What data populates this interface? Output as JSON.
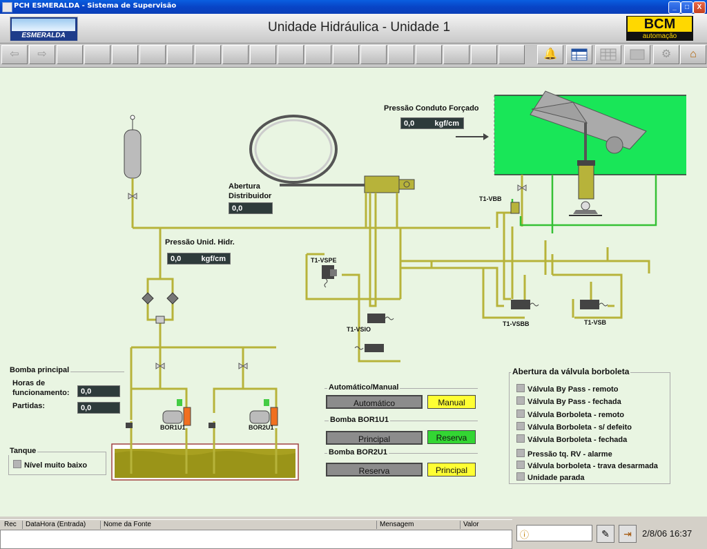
{
  "window": {
    "title": "PCH ESMERALDA - Sistema de Supervisão",
    "min": "_",
    "max": "□",
    "close": "X"
  },
  "header": {
    "logo_text": "ESMERALDA",
    "title": "Unidade Hidráulica - Unidade 1",
    "brand_top": "BCM",
    "brand_bottom": "automação"
  },
  "toolbar": {
    "back_icon": "arrow-left-icon",
    "forward_icon": "arrow-right-icon",
    "bell_icon": "bell-icon",
    "table_icon": "table-icon",
    "grid_icon": "grid-icon",
    "panel_icon": "panel-icon",
    "tools_icon": "tools-icon",
    "home_icon": "home-icon"
  },
  "readouts": {
    "conduto": {
      "label": "Pressão Conduto Forçado",
      "value": "0,0",
      "unit": "kgf/cm"
    },
    "distribuidor": {
      "label_line1": "Abertura",
      "label_line2": "Distribuidor",
      "value": "0,0"
    },
    "unid_hidr": {
      "label": "Pressão Unid. Hidr.",
      "value": "0,0",
      "unit": "kgf/cm"
    }
  },
  "valves": {
    "vbb": "T1-VBB",
    "vspe": "T1-VSPE",
    "vsio": "T1-VSIO",
    "vsbb": "T1-VSBB",
    "vsb": "T1-VSB"
  },
  "pumps": {
    "p1": "BOR1U1",
    "p2": "BOR2U1"
  },
  "bomba_principal": {
    "title": "Bomba principal",
    "horas_l1": "Horas de",
    "horas_l2": "funcionamento:",
    "horas_value": "0,0",
    "partidas_label": "Partidas:",
    "partidas_value": "0,0"
  },
  "tanque": {
    "title": "Tanque",
    "nivel": "Nível muito baixo"
  },
  "modo": {
    "title": "Automático/Manual",
    "btn1": "Automático",
    "btn2": "Manual"
  },
  "bor1": {
    "title": "Bomba BOR1U1",
    "btn1": "Principal",
    "btn2": "Reserva"
  },
  "bor2": {
    "title": "Bomba BOR2U1",
    "btn1": "Reserva",
    "btn2": "Principal"
  },
  "borboleta": {
    "title": "Abertura da válvula borboleta",
    "items": [
      "Válvula By Pass - remoto",
      "Válvula By Pass - fechada",
      "Válvula Borboleta - remoto",
      "Válvula Borboleta - s/ defeito",
      "Válvula Borboleta - fechada",
      "Pressão tq. RV - alarme",
      "Válvula borboleta - trava desarmada",
      "Unidade parada"
    ]
  },
  "alarm_columns": [
    "Rec",
    "DataHora (Entrada)",
    "Nome da Fonte",
    "Mensagem",
    "Valor"
  ],
  "status": {
    "datetime": "2/8/06 16:37"
  },
  "colors": {
    "pipe": "#b7b33a",
    "pipe_dark": "#6e6b18",
    "green_pipe": "#35c035",
    "conduit": "#19e658",
    "bg": "#e9f5e2"
  }
}
